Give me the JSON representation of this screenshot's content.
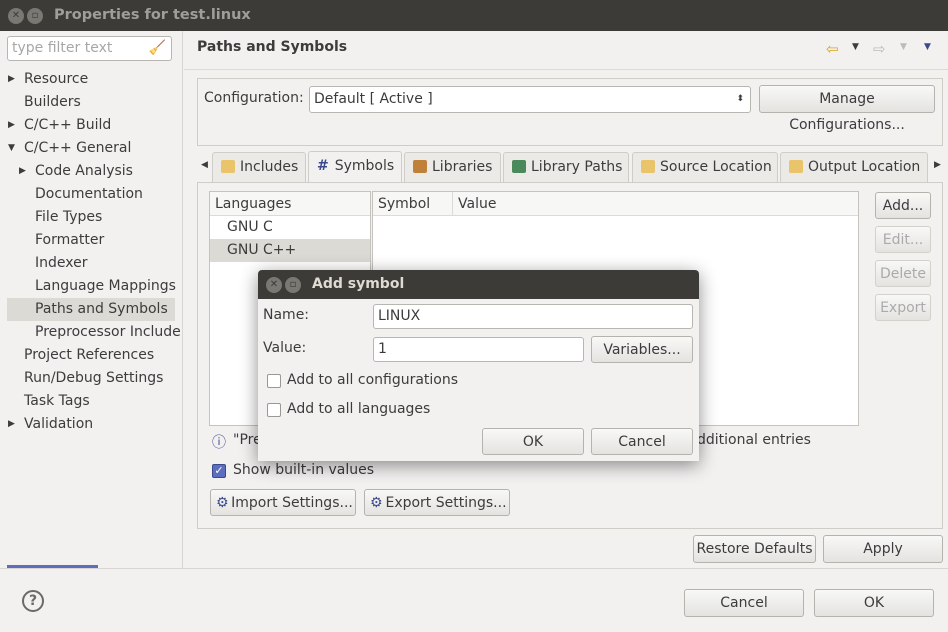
{
  "window": {
    "title": "Properties for test.linux"
  },
  "sidebar": {
    "filter_placeholder": "type filter text",
    "items": [
      {
        "label": "Resource",
        "expander": "collapsed",
        "level": 0
      },
      {
        "label": "Builders",
        "level": 0
      },
      {
        "label": "C/C++ Build",
        "expander": "collapsed",
        "level": 0
      },
      {
        "label": "C/C++ General",
        "expander": "expanded",
        "level": 0
      },
      {
        "label": "Code Analysis",
        "expander": "collapsed",
        "level": 1
      },
      {
        "label": "Documentation",
        "level": 1
      },
      {
        "label": "File Types",
        "level": 1
      },
      {
        "label": "Formatter",
        "level": 1
      },
      {
        "label": "Indexer",
        "level": 1
      },
      {
        "label": "Language Mappings",
        "level": 1
      },
      {
        "label": "Paths and Symbols",
        "level": 1,
        "selected": true
      },
      {
        "label": "Preprocessor Include",
        "level": 1
      },
      {
        "label": "Project References",
        "level": 0
      },
      {
        "label": "Run/Debug Settings",
        "level": 0
      },
      {
        "label": "Task Tags",
        "level": 0
      },
      {
        "label": "Validation",
        "expander": "collapsed",
        "level": 0
      }
    ]
  },
  "main": {
    "title": "Paths and Symbols",
    "config_label": "Configuration:",
    "config_value": "Default  [ Active ]",
    "manage_button": "Manage Configurations...",
    "tabs": [
      {
        "label": "Includes"
      },
      {
        "label": "Symbols",
        "active": true,
        "icon": "#"
      },
      {
        "label": "Libraries"
      },
      {
        "label": "Library Paths"
      },
      {
        "label": "Source Location"
      },
      {
        "label": "Output Location"
      }
    ],
    "languages_header": "Languages",
    "languages": [
      "GNU C",
      "GNU C++"
    ],
    "selected_language": "GNU C++",
    "symbol_columns": [
      "Symbol",
      "Value"
    ],
    "buttons": {
      "add": "Add...",
      "edit": "Edit...",
      "delete": "Delete",
      "export": "Export"
    },
    "info_text_left": "\"Pre",
    "info_text_right": "dditional entries",
    "show_builtin": "Show built-in values",
    "show_builtin_checked": true,
    "import_settings": "Import Settings...",
    "export_settings": "Export Settings...",
    "restore_defaults": "Restore Defaults",
    "apply": "Apply"
  },
  "footer": {
    "cancel": "Cancel",
    "ok": "OK"
  },
  "dialog": {
    "title": "Add symbol",
    "name_label": "Name:",
    "name_value": "LINUX",
    "value_label": "Value:",
    "value_value": "1",
    "variables": "Variables...",
    "all_configs": "Add to all configurations",
    "all_languages": "Add to all languages",
    "ok": "OK",
    "cancel": "Cancel"
  },
  "colors": {
    "titlebar": "#3c3b37",
    "selection": "#dcdad5",
    "accent": "#5e6ebf"
  }
}
